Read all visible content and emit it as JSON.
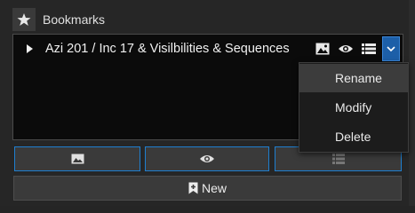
{
  "header": {
    "title": "Bookmarks",
    "icon": "star-icon"
  },
  "bookmark": {
    "label": "Azi 201 / Inc 17 & Visilbilities & Sequences",
    "icons": [
      "image-icon",
      "eye-icon",
      "list-icon"
    ],
    "dropdown_icon": "chevron-down-icon"
  },
  "menu": {
    "items": [
      {
        "label": "Rename",
        "highlighted": true
      },
      {
        "label": "Modify",
        "highlighted": false
      },
      {
        "label": "Delete",
        "highlighted": false
      }
    ]
  },
  "toolbar": {
    "buttons": [
      "image-icon",
      "eye-icon",
      "list-icon"
    ]
  },
  "new_button": {
    "label": "New",
    "icon": "bookmark-icon"
  },
  "colors": {
    "accent": "#1d5fa8",
    "border_accent": "#1e7fd0",
    "background": "#262626"
  }
}
